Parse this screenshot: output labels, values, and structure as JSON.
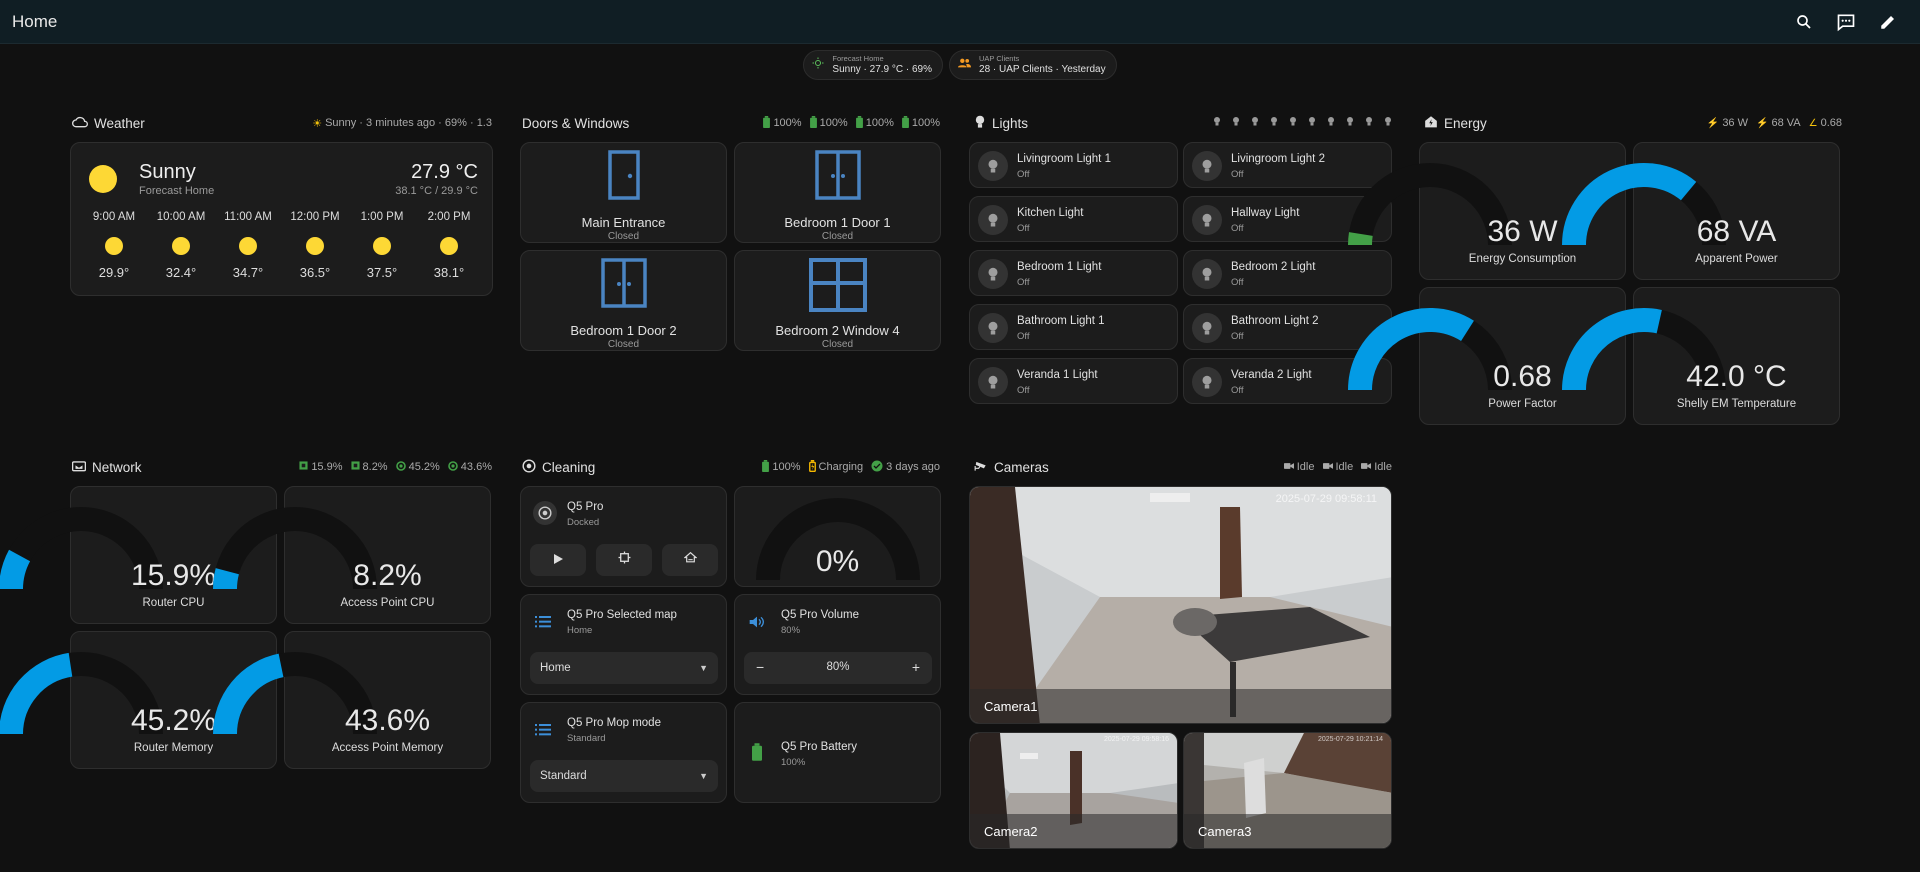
{
  "header": {
    "title": "Home"
  },
  "chips": [
    {
      "label": "Forecast Home",
      "value": "Sunny · 27.9 °C · 69%"
    },
    {
      "label": "UAP Clients",
      "value": "28 · UAP Clients · Yesterday"
    }
  ],
  "weather": {
    "title": "Weather",
    "badge": "Sunny · 3 minutes ago · 69% · 1.3",
    "condition": "Sunny",
    "location": "Forecast Home",
    "temp": "27.9 °C",
    "range": "38.1 °C / 29.9 °C",
    "forecast": [
      {
        "time": "9:00 AM",
        "temp": "29.9°"
      },
      {
        "time": "10:00 AM",
        "temp": "32.4°"
      },
      {
        "time": "11:00 AM",
        "temp": "34.7°"
      },
      {
        "time": "12:00 PM",
        "temp": "36.5°"
      },
      {
        "time": "1:00 PM",
        "temp": "37.5°"
      },
      {
        "time": "2:00 PM",
        "temp": "38.1°"
      }
    ]
  },
  "doors": {
    "title": "Doors & Windows",
    "badges": [
      "100%",
      "100%",
      "100%",
      "100%"
    ],
    "tiles": [
      {
        "name": "Main Entrance",
        "state": "Closed"
      },
      {
        "name": "Bedroom 1 Door 1",
        "state": "Closed"
      },
      {
        "name": "Bedroom 1 Door 2",
        "state": "Closed"
      },
      {
        "name": "Bedroom 2 Window 4",
        "state": "Closed"
      }
    ]
  },
  "lights": {
    "title": "Lights",
    "items": [
      {
        "name": "Livingroom Light 1",
        "state": "Off"
      },
      {
        "name": "Livingroom Light 2",
        "state": "Off"
      },
      {
        "name": "Kitchen Light",
        "state": "Off"
      },
      {
        "name": "Hallway Light",
        "state": "Off"
      },
      {
        "name": "Bedroom 1 Light",
        "state": "Off"
      },
      {
        "name": "Bedroom 2 Light",
        "state": "Off"
      },
      {
        "name": "Bathroom Light 1",
        "state": "Off"
      },
      {
        "name": "Bathroom Light 2",
        "state": "Off"
      },
      {
        "name": "Veranda 1 Light",
        "state": "Off"
      },
      {
        "name": "Veranda 2 Light",
        "state": "Off"
      }
    ]
  },
  "energy": {
    "title": "Energy",
    "badges": [
      "36 W",
      "68 VA",
      "0.68"
    ],
    "gauges": [
      {
        "value": "36 W",
        "label": "Energy Consumption",
        "fraction": 0.05,
        "color": "#43a047"
      },
      {
        "value": "68 VA",
        "label": "Apparent Power",
        "fraction": 0.72,
        "color": "#039be5"
      },
      {
        "value": "0.68",
        "label": "Power Factor",
        "fraction": 0.68,
        "color": "#039be5"
      },
      {
        "value": "42.0 °C",
        "label": "Shelly EM Temperature",
        "fraction": 0.57,
        "color": "#039be5"
      }
    ]
  },
  "network": {
    "title": "Network",
    "badges": [
      "15.9%",
      "8.2%",
      "45.2%",
      "43.6%"
    ],
    "gauges": [
      {
        "value": "15.9%",
        "label": "Router CPU",
        "fraction": 0.159,
        "color": "#039be5"
      },
      {
        "value": "8.2%",
        "label": "Access Point CPU",
        "fraction": 0.082,
        "color": "#039be5"
      },
      {
        "value": "45.2%",
        "label": "Router Memory",
        "fraction": 0.452,
        "color": "#039be5"
      },
      {
        "value": "43.6%",
        "label": "Access Point Memory",
        "fraction": 0.436,
        "color": "#039be5"
      }
    ]
  },
  "cleaning": {
    "title": "Cleaning",
    "badges": [
      "100%",
      "Charging",
      "3 days ago"
    ],
    "vacuum": {
      "name": "Q5 Pro",
      "state": "Docked"
    },
    "progress": {
      "value": "0%",
      "fraction": 0
    },
    "map": {
      "name": "Q5 Pro Selected map",
      "state": "Home",
      "selected": "Home"
    },
    "volume": {
      "name": "Q5 Pro Volume",
      "state": "80%",
      "value": "80%"
    },
    "mop": {
      "name": "Q5 Pro Mop mode",
      "state": "Standard",
      "selected": "Standard"
    },
    "battery": {
      "name": "Q5 Pro Battery",
      "state": "100%"
    }
  },
  "cameras": {
    "title": "Cameras",
    "badges": [
      "Idle",
      "Idle",
      "Idle"
    ],
    "items": [
      {
        "name": "Camera1",
        "timestamp": "2025-07-29 09:58:11"
      },
      {
        "name": "Camera2",
        "timestamp": "2025-07-29 09:58:16"
      },
      {
        "name": "Camera3",
        "timestamp": "2025-07-29 10:21:14"
      }
    ]
  }
}
